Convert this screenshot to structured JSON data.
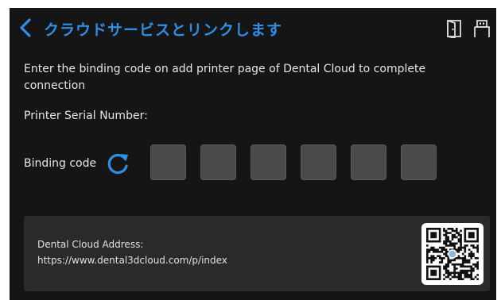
{
  "header": {
    "title": "クラウドサービスとリンクします",
    "back_icon": "chevron-left-icon",
    "icons": [
      "door-icon",
      "usb-icon"
    ]
  },
  "instruction": "Enter the binding code on add printer page of Dental Cloud to complete connection",
  "serial": {
    "label": "Printer Serial Number:"
  },
  "binding": {
    "label": "Binding code",
    "refresh_icon": "refresh-icon",
    "code_digits": [
      "",
      "",
      "",
      "",
      "",
      ""
    ]
  },
  "address": {
    "label": "Dental Cloud Address:",
    "url": "https://www.dental3dcloud.com/p/index",
    "qr_icon": "qr-code-icon"
  },
  "colors": {
    "background": "#151515",
    "accent": "#2f8fe6",
    "code_box": "#4a4a4a",
    "panel": "#2a2a2a"
  }
}
